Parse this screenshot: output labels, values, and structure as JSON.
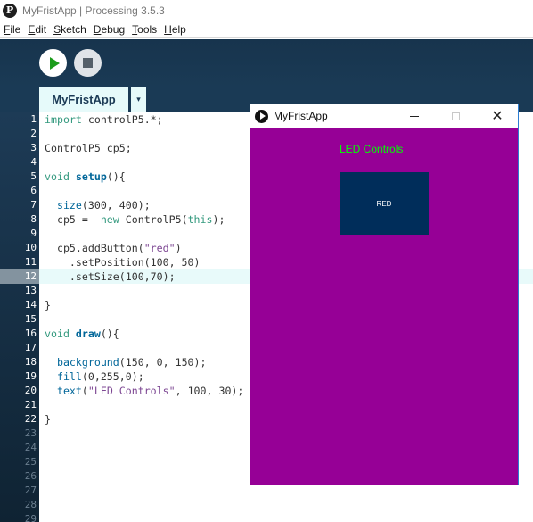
{
  "app": {
    "title": "MyFristApp | Processing 3.5.3",
    "icon_letter": "P"
  },
  "menu": {
    "items": [
      {
        "key": "F",
        "rest": "ile"
      },
      {
        "key": "E",
        "rest": "dit"
      },
      {
        "key": "S",
        "rest": "ketch"
      },
      {
        "key": "D",
        "rest": "ebug"
      },
      {
        "key": "T",
        "rest": "ools"
      },
      {
        "key": "H",
        "rest": "elp"
      }
    ]
  },
  "toolbar": {
    "run_icon": "play-icon",
    "stop_icon": "stop-icon"
  },
  "tabs": {
    "active_label": "MyFristApp",
    "dropdown_glyph": "▾"
  },
  "editor": {
    "highlighted_line": 12,
    "line_numbers": [
      "1",
      "2",
      "3",
      "4",
      "5",
      "6",
      "7",
      "8",
      "9",
      "10",
      "11",
      "12",
      "13",
      "14",
      "15",
      "16",
      "17",
      "18",
      "19",
      "20",
      "21",
      "22",
      "23",
      "24",
      "25",
      "26",
      "27",
      "28",
      "29"
    ],
    "lines": [
      [
        {
          "t": "import",
          "c": "kw"
        },
        {
          "t": " controlP5.*;",
          "c": ""
        }
      ],
      [],
      [
        {
          "t": "ControlP5 cp5;",
          "c": ""
        }
      ],
      [],
      [
        {
          "t": "void",
          "c": "kw"
        },
        {
          "t": " ",
          "c": ""
        },
        {
          "t": "setup",
          "c": "fnb"
        },
        {
          "t": "(){",
          "c": ""
        }
      ],
      [],
      [
        {
          "t": "  ",
          "c": ""
        },
        {
          "t": "size",
          "c": "fn"
        },
        {
          "t": "(300, 400);",
          "c": ""
        }
      ],
      [
        {
          "t": "  cp5 =  ",
          "c": ""
        },
        {
          "t": "new",
          "c": "kw"
        },
        {
          "t": " ControlP5(",
          "c": ""
        },
        {
          "t": "this",
          "c": "kw"
        },
        {
          "t": ");",
          "c": ""
        }
      ],
      [],
      [
        {
          "t": "  cp5.addButton(",
          "c": ""
        },
        {
          "t": "\"red\"",
          "c": "str"
        },
        {
          "t": ")",
          "c": ""
        }
      ],
      [
        {
          "t": "    .setPosition(100, 50)",
          "c": ""
        }
      ],
      [
        {
          "t": "    .setSize(100,70);",
          "c": ""
        }
      ],
      [],
      [
        {
          "t": "}",
          "c": ""
        }
      ],
      [],
      [
        {
          "t": "void",
          "c": "kw"
        },
        {
          "t": " ",
          "c": ""
        },
        {
          "t": "draw",
          "c": "fnb"
        },
        {
          "t": "(){",
          "c": ""
        }
      ],
      [],
      [
        {
          "t": "  ",
          "c": ""
        },
        {
          "t": "background",
          "c": "fn"
        },
        {
          "t": "(150, 0, 150);",
          "c": ""
        }
      ],
      [
        {
          "t": "  ",
          "c": ""
        },
        {
          "t": "fill",
          "c": "fn"
        },
        {
          "t": "(0,255,0);",
          "c": ""
        }
      ],
      [
        {
          "t": "  ",
          "c": ""
        },
        {
          "t": "text",
          "c": "fn"
        },
        {
          "t": "(",
          "c": ""
        },
        {
          "t": "\"LED Controls\"",
          "c": "str"
        },
        {
          "t": ", 100, 30);",
          "c": ""
        }
      ],
      [],
      [
        {
          "t": "}",
          "c": ""
        }
      ]
    ]
  },
  "sketch_window": {
    "title": "MyFristApp",
    "close_glyph": "✕",
    "canvas_color": "#960096",
    "heading": "LED Controls",
    "heading_color": "#00ff00",
    "button_label": "RED",
    "button_color": "#002d5a"
  }
}
